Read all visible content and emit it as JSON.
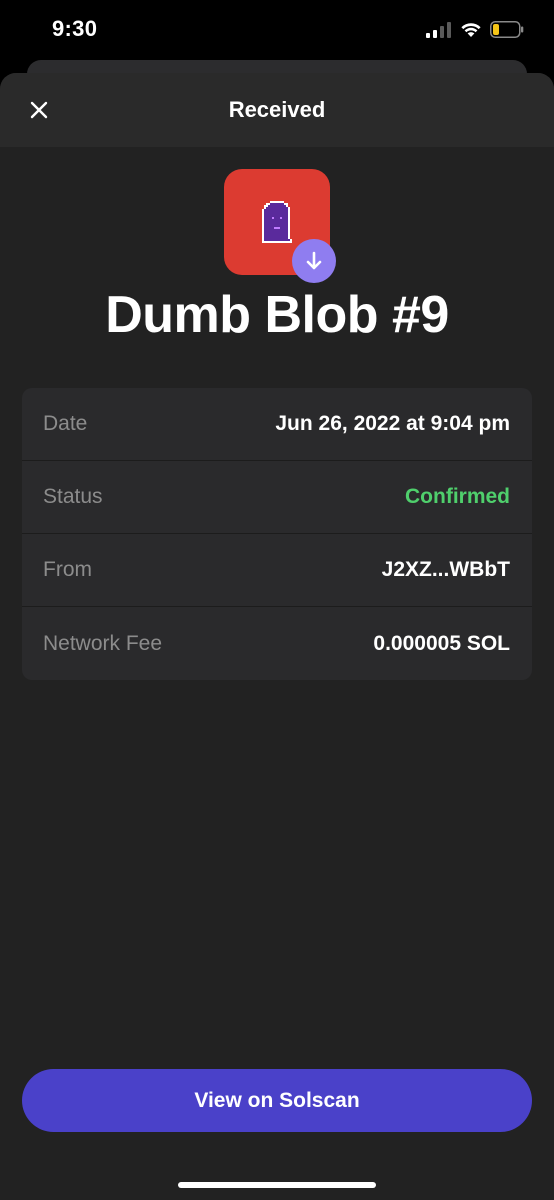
{
  "status_bar": {
    "time": "9:30"
  },
  "header": {
    "title": "Received",
    "close_icon": "close-icon"
  },
  "nft": {
    "name": "Dumb Blob #9",
    "tile_color": "#dc3b31",
    "badge_color": "#8f7df0",
    "badge_icon": "arrow-down-icon"
  },
  "details": [
    {
      "label": "Date",
      "value": "Jun 26, 2022 at 9:04 pm"
    },
    {
      "label": "Status",
      "value": "Confirmed",
      "status_color": "#4fcf6c"
    },
    {
      "label": "From",
      "value": "J2XZ...WBbT"
    },
    {
      "label": "Network Fee",
      "value": "0.000005 SOL"
    }
  ],
  "actions": {
    "solscan_label": "View on Solscan",
    "button_color": "#4a41c9"
  }
}
